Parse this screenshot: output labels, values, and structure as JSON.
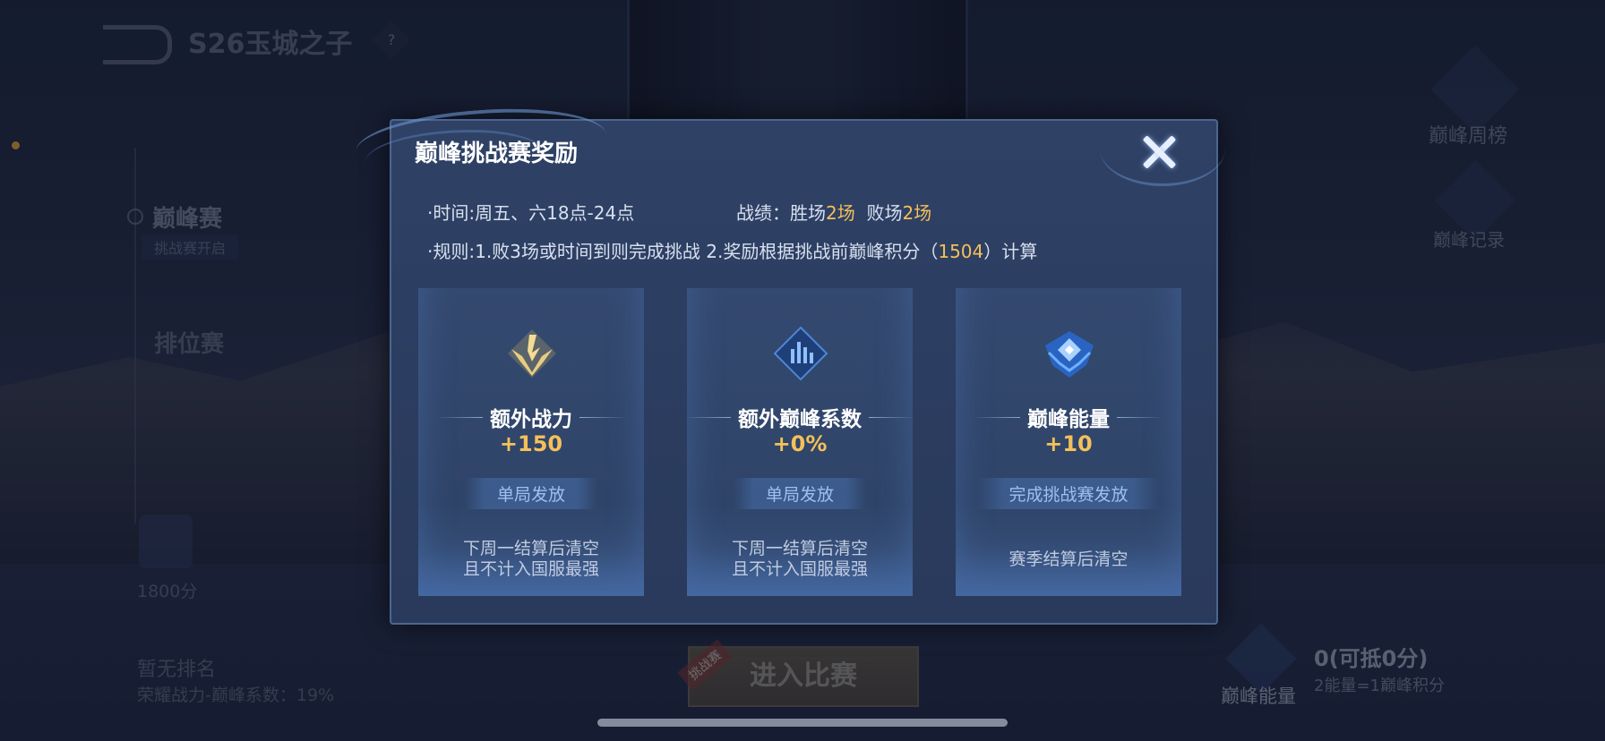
{
  "background": {
    "season_title": "S26玉城之子",
    "help_icon": "?",
    "sidebar": {
      "peak_label": "巅峰赛",
      "peak_sub": "挑战赛开启",
      "rank_label": "排位赛"
    },
    "left_stats": {
      "score": "1800分",
      "no_rank": "暂无排名",
      "glory_coef": "荣耀战力-巅峰系数：19%"
    },
    "right_menu": {
      "weekly": "巅峰周榜",
      "record": "巅峰记录"
    },
    "energy": {
      "label": "巅峰能量",
      "value": "0(可抵0分)",
      "rate": "2能量=1巅峰积分"
    },
    "enter_button": "进入比赛",
    "challenge_tag": "挑战赛"
  },
  "modal": {
    "title": "巅峰挑战赛奖励",
    "time_label": "·时间:周五、六18点-24点",
    "record_prefix": "战绩：胜场",
    "wins": "2场",
    "losses_prefix": "败场",
    "losses": "2场",
    "rule_prefix": "·规则:1.败3场或时间到则完成挑战 2.奖励根据挑战前巅峰积分（",
    "rule_score": "1504",
    "rule_suffix": "）计算",
    "cards": [
      {
        "icon": "combat-power-icon",
        "name": "额外战力",
        "value": "+150",
        "tag": "单局发放",
        "note1": "下周一结算后清空",
        "note2": "且不计入国服最强"
      },
      {
        "icon": "peak-coefficient-icon",
        "name": "额外巅峰系数",
        "value": "+0%",
        "tag": "单局发放",
        "note1": "下周一结算后清空",
        "note2": "且不计入国服最强"
      },
      {
        "icon": "peak-energy-icon",
        "name": "巅峰能量",
        "value": "+10",
        "tag": "完成挑战赛发放",
        "note1": "赛季结算后清空"
      }
    ]
  },
  "colors": {
    "gold": "#f4c05a",
    "modal_bg": "#2b3d60",
    "accent_blue": "#9cc0f0"
  }
}
